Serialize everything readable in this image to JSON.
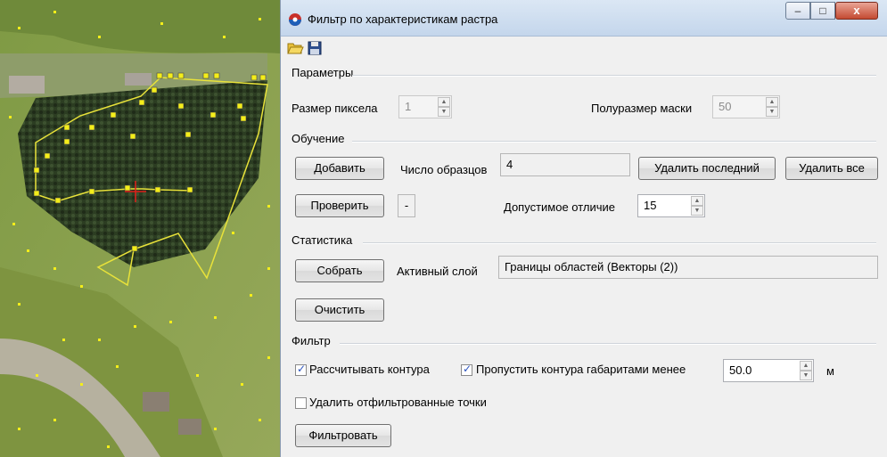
{
  "window": {
    "title": "Фильтр по характеристикам растра",
    "close_glyph": "x",
    "min_glyph": "–",
    "max_glyph": "□"
  },
  "toolbar": {
    "open_icon": "folder-open-icon",
    "save_icon": "floppy-save-icon"
  },
  "params": {
    "section": "Параметры",
    "pixel_label": "Размер пиксела",
    "pixel_value": "1",
    "mask_label": "Полуразмер маски",
    "mask_value": "50"
  },
  "training": {
    "section": "Обучение",
    "add_button": "Добавить",
    "samples_label": "Число образцов",
    "samples_value": "4",
    "delete_last_button": "Удалить последний",
    "delete_all_button": "Удалить все",
    "check_button": "Проверить",
    "check_result": "-",
    "tolerance_label": "Допустимое отличие",
    "tolerance_value": "15"
  },
  "stats": {
    "section": "Статистика",
    "collect_button": "Собрать",
    "layer_label": "Активный слой",
    "layer_value": "Границы областей (Векторы (2))",
    "clear_button": "Очистить"
  },
  "filter": {
    "section": "Фильтр",
    "calc_contours_label": "Рассчитывать контура",
    "calc_contours_checked": true,
    "skip_contours_label": "Пропустить контура габаритами менее",
    "skip_contours_checked": true,
    "skip_value": "50.0",
    "unit": "м",
    "delete_points_label": "Удалить отфильтрованные точки",
    "delete_points_checked": false,
    "filter_button": "Фильтровать"
  },
  "colors": {
    "vector_line": "#e8e23a",
    "point_fill": "#f4ee1a",
    "forest": "#2c3d22",
    "meadow": "#8fa24e"
  }
}
